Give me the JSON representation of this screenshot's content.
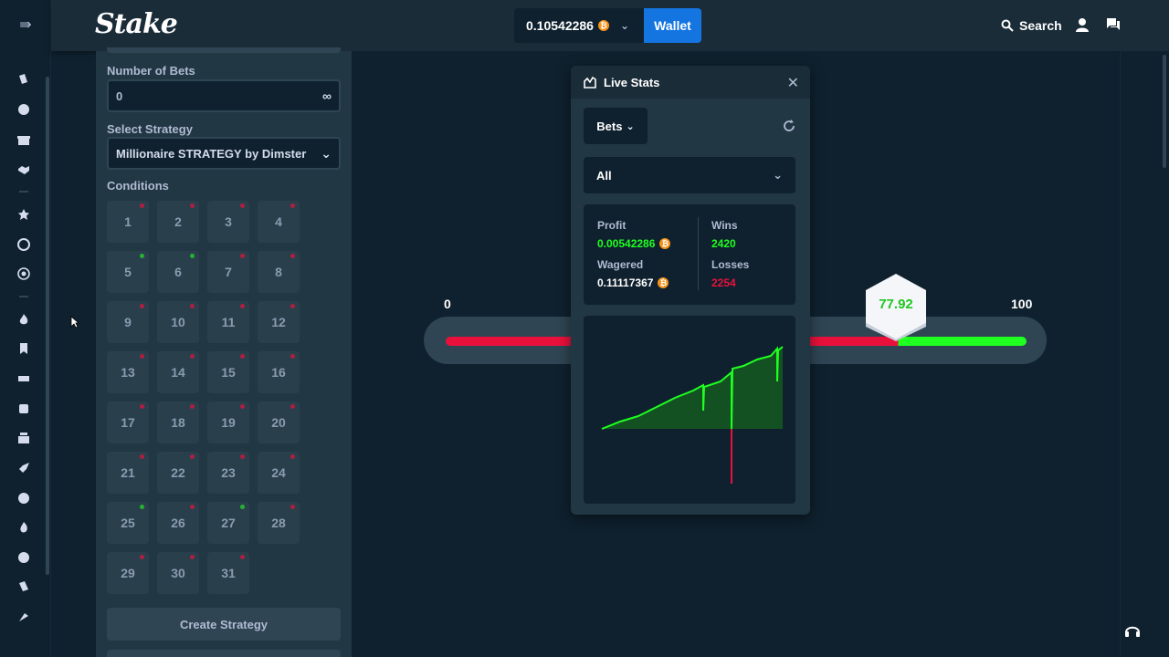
{
  "header": {
    "logo": "Stake",
    "balance": "0.10542286",
    "wallet_label": "Wallet",
    "search_label": "Search"
  },
  "panel": {
    "number_of_bets_label": "Number of Bets",
    "number_of_bets_value": "0",
    "select_strategy_label": "Select Strategy",
    "select_strategy_value": "Millionaire STRATEGY by Dimster",
    "conditions_label": "Conditions",
    "conditions": [
      {
        "n": "1",
        "dot": "red"
      },
      {
        "n": "2",
        "dot": "red"
      },
      {
        "n": "3",
        "dot": "red"
      },
      {
        "n": "4",
        "dot": "red"
      },
      {
        "n": "5",
        "dot": "green"
      },
      {
        "n": "6",
        "dot": "green"
      },
      {
        "n": "7",
        "dot": "red"
      },
      {
        "n": "8",
        "dot": "red"
      },
      {
        "n": "9",
        "dot": "red"
      },
      {
        "n": "10",
        "dot": "red"
      },
      {
        "n": "11",
        "dot": "red"
      },
      {
        "n": "12",
        "dot": "red"
      },
      {
        "n": "13",
        "dot": "red"
      },
      {
        "n": "14",
        "dot": "red"
      },
      {
        "n": "15",
        "dot": "red"
      },
      {
        "n": "16",
        "dot": "red"
      },
      {
        "n": "17",
        "dot": "red"
      },
      {
        "n": "18",
        "dot": "red"
      },
      {
        "n": "19",
        "dot": "red"
      },
      {
        "n": "20",
        "dot": "red"
      },
      {
        "n": "21",
        "dot": "red"
      },
      {
        "n": "22",
        "dot": "red"
      },
      {
        "n": "23",
        "dot": "red"
      },
      {
        "n": "24",
        "dot": "red"
      },
      {
        "n": "25",
        "dot": "green"
      },
      {
        "n": "26",
        "dot": "red"
      },
      {
        "n": "27",
        "dot": "green"
      },
      {
        "n": "28",
        "dot": "red"
      },
      {
        "n": "29",
        "dot": "red"
      },
      {
        "n": "30",
        "dot": "red"
      },
      {
        "n": "31",
        "dot": "red"
      }
    ],
    "create_strategy_label": "Create Strategy"
  },
  "game": {
    "min_label": "0",
    "max_label": "100",
    "result": "77.92",
    "result_value": 77.92
  },
  "live_stats": {
    "title": "Live Stats",
    "bets_label": "Bets",
    "filter_value": "All",
    "profit_label": "Profit",
    "profit_value": "0.00542286",
    "wagered_label": "Wagered",
    "wagered_value": "0.11117367",
    "wins_label": "Wins",
    "wins_value": "2420",
    "losses_label": "Losses",
    "losses_value": "2254"
  },
  "colors": {
    "accent": "#1475e1",
    "win": "#1fff20",
    "loss": "#e9113c",
    "btc": "#f7931a",
    "panel": "#213743",
    "background": "#0f212e"
  },
  "icons": {
    "menu": "menu-collapse-icon",
    "btc": "bitcoin-icon",
    "search": "search-icon",
    "user": "user-icon",
    "chat": "chat-icon",
    "infinity": "infinity-icon",
    "stats": "chart-icon",
    "close": "close-icon",
    "refresh": "refresh-icon",
    "support": "headset-icon"
  }
}
